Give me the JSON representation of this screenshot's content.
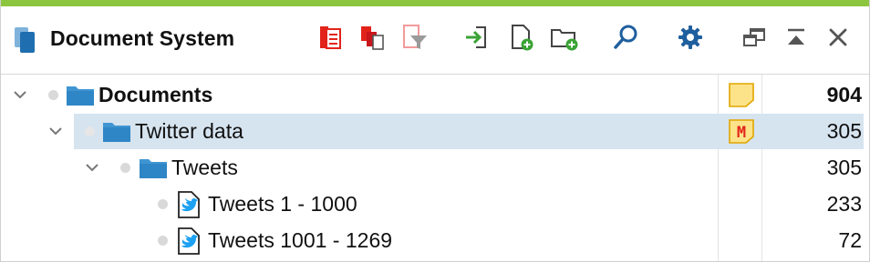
{
  "window": {
    "title": "Document System",
    "accent_color": "#8cc63f"
  },
  "toolbar": {
    "icons": [
      "activate-documents-icon",
      "copy-documents-icon",
      "filter-documents-icon",
      "import-icon",
      "new-document-icon",
      "new-document-group-icon",
      "search-icon",
      "settings-icon",
      "undock-window-icon",
      "collapse-window-icon",
      "close-icon"
    ]
  },
  "tree": {
    "rows": [
      {
        "label": "Documents",
        "count": "904",
        "memo": "yellow-memo-icon",
        "expanded": true,
        "bold": true
      },
      {
        "label": "Twitter data",
        "count": "305",
        "memo": "m-memo-icon",
        "memo_text": "M",
        "expanded": true,
        "selected": true
      },
      {
        "label": "Tweets",
        "count": "305",
        "expanded": true
      },
      {
        "label": "Tweets 1 - 1000",
        "count": "233",
        "icon": "twitter-document-icon"
      },
      {
        "label": "Tweets 1001 - 1269",
        "count": "72",
        "icon": "twitter-document-icon"
      }
    ]
  },
  "colors": {
    "selection": "#d6e4f0",
    "folder": "#3f95d2",
    "twitter": "#1da1f2",
    "memo_yellow": "#fce38a",
    "memo_border": "#e0a500",
    "memo_m": "#e2231a"
  }
}
